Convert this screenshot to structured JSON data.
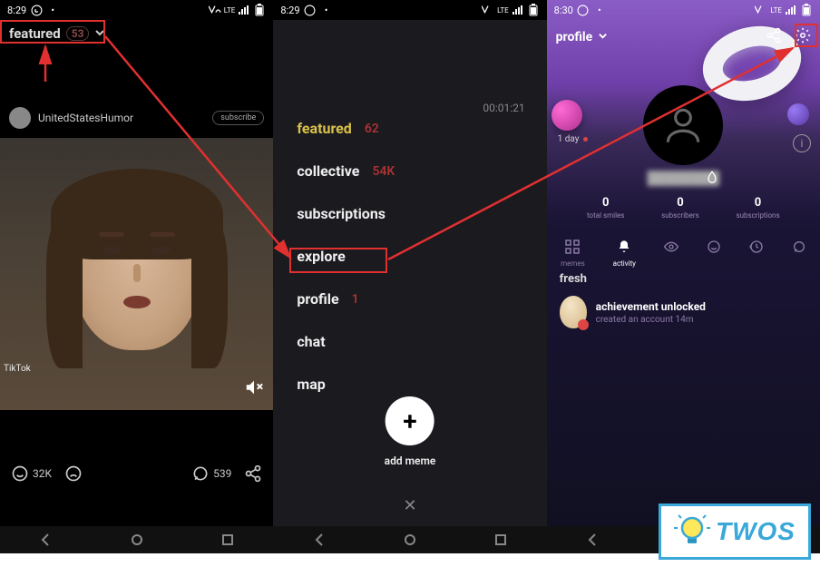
{
  "panel1": {
    "statusbar": {
      "time": "8:29",
      "network": "LTE"
    },
    "header": {
      "title": "featured",
      "count": "53"
    },
    "post": {
      "username": "UnitedStatesHumor",
      "subscribe": "subscribe",
      "source": "TikTok"
    },
    "actions": {
      "smiles": "32K",
      "comments": "539"
    }
  },
  "panel2": {
    "statusbar": {
      "time": "8:29",
      "network": "LTE"
    },
    "timer": "00:01:21",
    "menu": {
      "featured": {
        "label": "featured",
        "count": "62"
      },
      "collective": {
        "label": "collective",
        "count": "54K"
      },
      "subscriptions": {
        "label": "subscriptions"
      },
      "explore": {
        "label": "explore"
      },
      "profile": {
        "label": "profile",
        "count": "1"
      },
      "chat": {
        "label": "chat"
      },
      "map": {
        "label": "map"
      }
    },
    "addmeme": {
      "label": "add meme"
    }
  },
  "panel3": {
    "statusbar": {
      "time": "8:30",
      "network": "LTE"
    },
    "header": {
      "title": "profile"
    },
    "daytag": "1 day",
    "username": "████████",
    "stats": {
      "smiles": {
        "value": "0",
        "label": "total smiles"
      },
      "subscribers": {
        "value": "0",
        "label": "subscribers"
      },
      "subscriptions": {
        "value": "0",
        "label": "subscriptions"
      }
    },
    "tabs": {
      "memes": "memes",
      "activity": "activity",
      "watched": "",
      "smiled": "",
      "history": "",
      "comments": ""
    },
    "fresh": "fresh",
    "achievement": {
      "title": "achievement unlocked",
      "subtitle": "created an account 14m"
    }
  },
  "logo": {
    "text": "TWOS"
  }
}
